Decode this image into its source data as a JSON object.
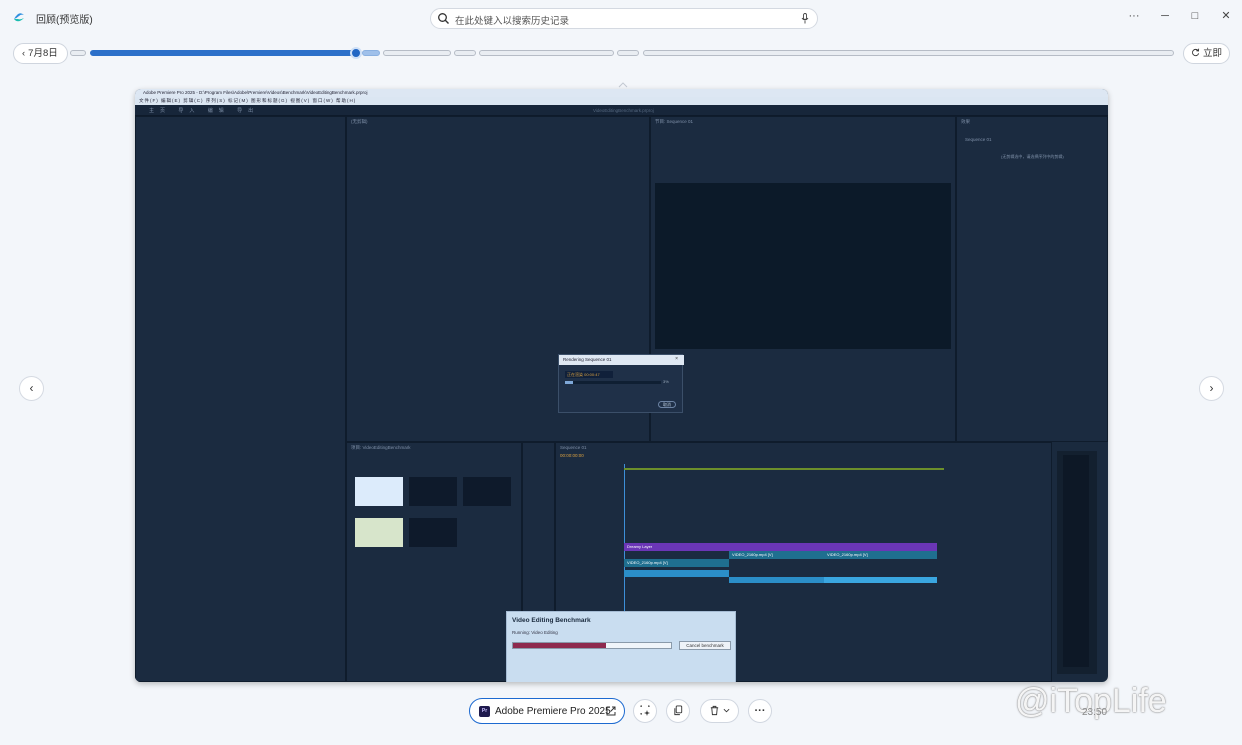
{
  "window": {
    "title": "回顾(预览版)",
    "minimize": "─",
    "maximize": "□",
    "close": "✕",
    "more": "···"
  },
  "search": {
    "placeholder": "在此处键入以搜索历史记录"
  },
  "timeline": {
    "date_label": "7月8日",
    "now_label": "立即",
    "position": 0.46
  },
  "nav": {
    "prev": "‹",
    "next": "›"
  },
  "snapshot": {
    "app_title": "Adobe Premiere Pro 2025 - D:\\Program Files\\Adobe\\Premiere\\Videos\\Benchmark\\VideoEditingBenchmark.prproj",
    "menu": "文件(F) 编辑(E) 剪辑(C) 序列(S) 标记(M) 图形和标题(G) 视图(V) 窗口(W) 帮助(H)",
    "workspace_tabs": "主页 导入 编辑 导出",
    "project_name": "VideoEditingBenchmark.prproj",
    "panels": {
      "source": "(无剪辑)",
      "program": "节目: Sequence 01",
      "effects": "效果",
      "effects_item": "Sequence 01",
      "effects_note": "(无剪辑选中，请选择序列中的剪辑)",
      "project": "项目: VideoEditingBenchmark",
      "timeline": "Sequence 01",
      "timecode": "00:00:00:00"
    },
    "render_dialog": {
      "title": "Rendering Sequence 01",
      "status": "正在渲染 00:00:47",
      "percent": "3%",
      "cancel": "取消",
      "progress": 0.08
    },
    "clips": {
      "title_layer": "Dreamy Layer",
      "video_a": "VIDEO_2160p.mp4 [V]",
      "video_b": "VIDEO_2160p.mp4 [V]",
      "video_c": "VIDEO_2160p.mp4 [V]"
    },
    "benchmark": {
      "title": "Video Editing Benchmark",
      "status": "Running: Video Editing",
      "cancel": "Cancel benchmark",
      "progress": 0.59
    }
  },
  "toolbar": {
    "app_name": "Adobe Premiere Pro 2025",
    "app_icon_text": "Pr"
  },
  "overlay": {
    "watermark": "@iTopLife",
    "time": "23:50"
  },
  "colors": {
    "accent": "#2c70c9",
    "snapshot_bg": "#1a2a3e",
    "purple_clip": "#6b36b6",
    "teal_clip": "#1f6f8f",
    "audio_clip": "#3aa6e0",
    "benchmark_bar": "#8e2a4e"
  }
}
